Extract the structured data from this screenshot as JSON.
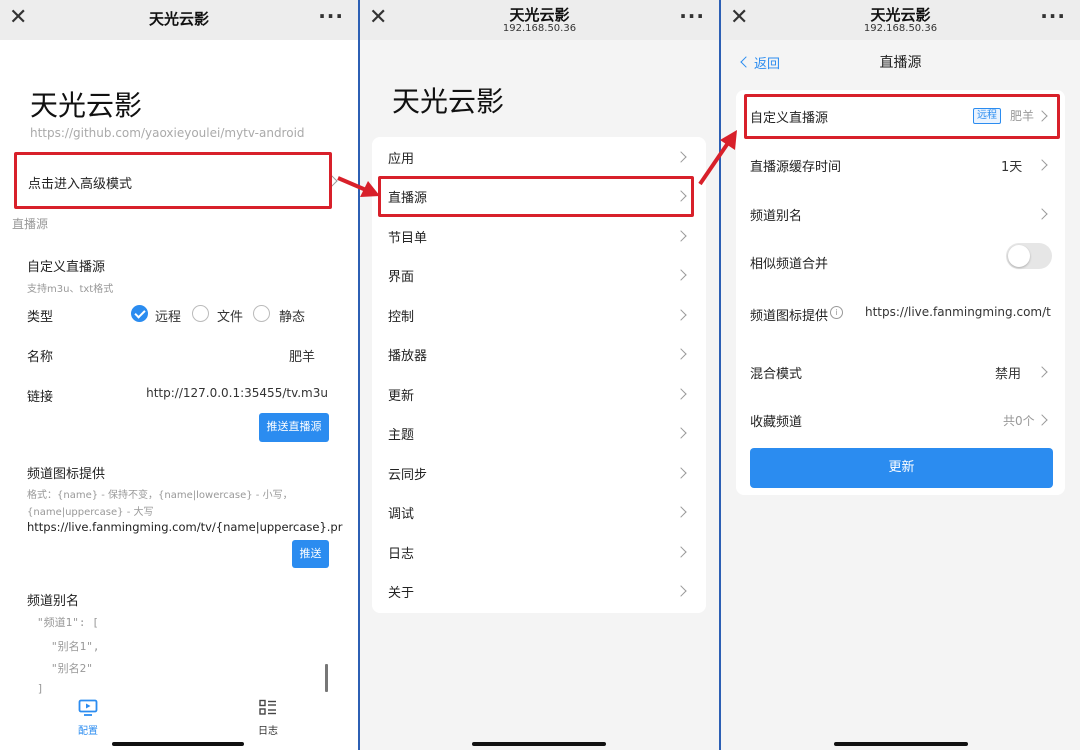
{
  "colors": {
    "accent": "#2b8cf0",
    "highlight_box": "#d8202a",
    "panel_separator": "#2c5fb4"
  },
  "panel1": {
    "topbar": {
      "title": "天光云影"
    },
    "app_title": "天光云影",
    "repo_url": "https://github.com/yaoxieyoulei/mytv-android",
    "advanced_mode": "点击进入高级模式",
    "section_live": "直播源",
    "custom_source": {
      "title": "自定义直播源",
      "hint": "支持m3u、txt格式",
      "type_label": "类型",
      "type_options": [
        "远程",
        "文件",
        "静态"
      ],
      "type_selected": "远程",
      "name_label": "名称",
      "name_value": "肥羊",
      "link_label": "链接",
      "link_value": "http://127.0.0.1:35455/tv.m3u",
      "push_button": "推送直播源"
    },
    "icon_provider": {
      "title": "频道图标提供",
      "hint_line1": "格式：{name} - 保持不变，{name|lowercase} - 小写，",
      "hint_line2": "{name|uppercase} - 大写",
      "value": "https://live.fanmingming.com/tv/{name|uppercase}.pr",
      "push_button": "推送"
    },
    "alias": {
      "title": "频道别名",
      "code_lines": [
        "\"频道1\": [",
        "\"别名1\",",
        "\"别名2\"",
        "]"
      ]
    },
    "bottom_nav": [
      {
        "label": "配置",
        "icon": "monitor-play-icon",
        "active": true
      },
      {
        "label": "日志",
        "icon": "list-icon",
        "active": false
      }
    ]
  },
  "panel2": {
    "topbar": {
      "title": "天光云影",
      "subtitle": "192.168.50.36"
    },
    "app_title": "天光云影",
    "menu": [
      "应用",
      "直播源",
      "节目单",
      "界面",
      "控制",
      "播放器",
      "更新",
      "主题",
      "云同步",
      "调试",
      "日志",
      "关于"
    ],
    "highlighted": "直播源"
  },
  "panel3": {
    "topbar": {
      "title": "天光云影",
      "subtitle": "192.168.50.36"
    },
    "back_label": "返回",
    "page_title": "直播源",
    "rows": {
      "custom_source": {
        "label": "自定义直播源",
        "tag": "远程",
        "value": "肥羊"
      },
      "cache_time": {
        "label": "直播源缓存时间",
        "value": "1天"
      },
      "alias": {
        "label": "频道别名"
      },
      "merge": {
        "label": "相似频道合并"
      },
      "icon_provider": {
        "label": "频道图标提供",
        "value": "https://live.fanmingming.com/t"
      },
      "mix_mode": {
        "label": "混合模式",
        "value": "禁用"
      },
      "favorites": {
        "label": "收藏频道",
        "value": "共0个"
      }
    },
    "update_button": "更新"
  }
}
